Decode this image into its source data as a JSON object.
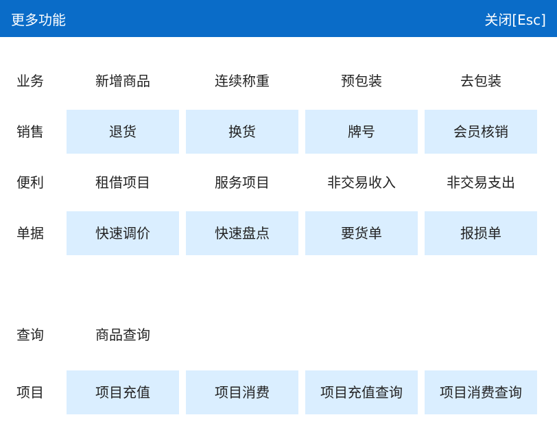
{
  "window": {
    "title": "更多功能",
    "close_label": "关闭[Esc]"
  },
  "colors": {
    "titlebar_bg": "#0a6cc8",
    "item_highlight_bg": "#daeeff",
    "text": "#222222"
  },
  "sections": [
    {
      "label": "业务",
      "items": [
        "新增商品",
        "连续称重",
        "预包装",
        "去包装"
      ]
    },
    {
      "label": "销售",
      "items": [
        "退货",
        "换货",
        "牌号",
        "会员核销"
      ]
    },
    {
      "label": "便利",
      "items": [
        "租借项目",
        "服务项目",
        "非交易收入",
        "非交易支出"
      ]
    },
    {
      "label": "单据",
      "items": [
        "快速调价",
        "快速盘点",
        "要货单",
        "报损单"
      ]
    },
    {
      "label": "查询",
      "items": [
        "商品查询"
      ]
    },
    {
      "label": "项目",
      "items": [
        "项目充值",
        "项目消费",
        "项目充值查询",
        "项目消费查询"
      ]
    }
  ]
}
